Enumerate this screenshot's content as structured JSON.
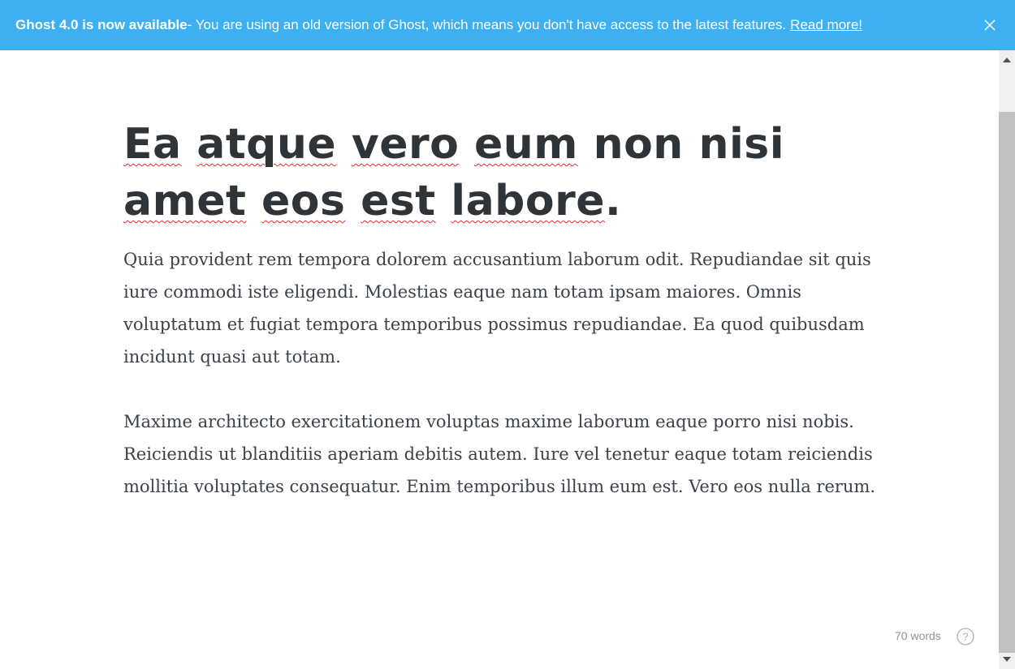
{
  "banner": {
    "strong": "Ghost 4.0 is now available",
    "message": " - You are using an old version of Ghost, which means you don't have access to the latest features.",
    "link": "Read more!",
    "close_icon": "close-icon",
    "background": "#3eb0ef"
  },
  "post": {
    "title_words": [
      "Ea",
      "atque",
      "vero",
      "eum",
      "non",
      "nisi",
      "amet",
      "eos",
      "est",
      "labore"
    ],
    "title_end": ".",
    "paragraphs": [
      "Quia provident rem tempora dolorem accusantium laborum odit. Repudiandae sit quis iure commodi iste eligendi. Molestias eaque nam totam ipsam maiores. Omnis voluptatum et fugiat tempora temporibus possimus repudiandae. Ea quod quibusdam incidunt quasi aut totam.",
      "Maxime architecto exercitationem voluptas maxime laborum eaque porro nisi nobis. Reiciendis ut blanditiis aperiam debitis autem. Iure vel tenetur eaque totam reiciendis mollitia voluptates consequatur. Enim temporibus illum eum est. Vero eos nulla rerum."
    ]
  },
  "footer": {
    "word_count": "70 words",
    "help_icon": "help-circle-icon"
  }
}
